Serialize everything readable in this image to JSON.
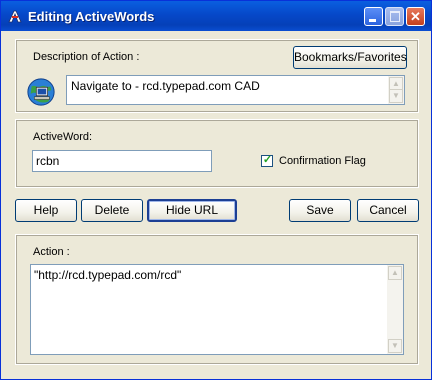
{
  "window": {
    "title": "Editing ActiveWords"
  },
  "description": {
    "label": "Description of Action :",
    "bookmarks_button": "Bookmarks/Favorites",
    "value": "Navigate to - rcd.typepad.com CAD"
  },
  "activeword": {
    "label": "ActiveWord:",
    "value": "rcbn",
    "confirmation_label": "Confirmation Flag",
    "confirmation_checked": true
  },
  "buttons": {
    "help": "Help",
    "delete": "Delete",
    "hide_url": "Hide URL",
    "save": "Save",
    "cancel": "Cancel"
  },
  "action": {
    "label": "Action :",
    "value": "\"http://rcd.typepad.com/rcd\""
  },
  "icons": {
    "title_icon": "activewords-app-icon",
    "description_icon": "globe-computer-icon"
  }
}
